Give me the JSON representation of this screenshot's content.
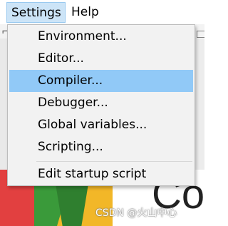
{
  "menubar": {
    "items": [
      {
        "label": "Settings"
      },
      {
        "label": "Help"
      }
    ]
  },
  "settings_menu": {
    "items": [
      {
        "label": "Environment..."
      },
      {
        "label": "Editor..."
      },
      {
        "label": "Compiler..."
      },
      {
        "label": "Debugger..."
      },
      {
        "label": "Global variables..."
      },
      {
        "label": "Scripting..."
      },
      {
        "label": "Edit startup script"
      }
    ],
    "highlighted_index": 2
  },
  "background": {
    "logo_text": "Co",
    "watermark": "CSDN @火山中心"
  },
  "colors": {
    "menubar_open_bg": "#cce4f7",
    "menu_highlight": "#91c9f7",
    "menu_bg": "#f2f2f2",
    "logo_red": "#e24040",
    "logo_green": "#3a9a3a",
    "logo_yellow": "#f2b728"
  }
}
